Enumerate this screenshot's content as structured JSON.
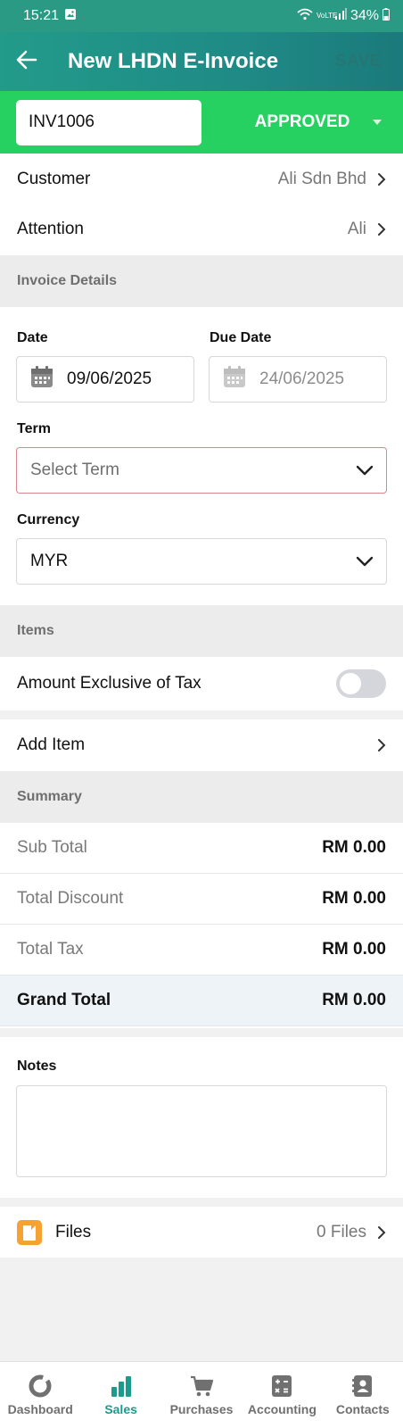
{
  "status_bar": {
    "time": "15:21",
    "network": "VoLTE",
    "battery": "34%"
  },
  "app_bar": {
    "title": "New LHDN E-Invoice",
    "save_label": "SAVE"
  },
  "invoice": {
    "number": "INV1006",
    "status": "APPROVED"
  },
  "party": {
    "customer_label": "Customer",
    "customer_value": "Ali Sdn Bhd",
    "attention_label": "Attention",
    "attention_value": "Ali"
  },
  "invoice_details": {
    "header": "Invoice Details",
    "date_label": "Date",
    "date_value": "09/06/2025",
    "due_date_label": "Due Date",
    "due_date_value": "24/06/2025",
    "term_label": "Term",
    "term_placeholder": "Select Term",
    "currency_label": "Currency",
    "currency_value": "MYR"
  },
  "items": {
    "header": "Items",
    "amount_exclusive_label": "Amount Exclusive of Tax",
    "amount_exclusive_on": false,
    "add_item_label": "Add Item"
  },
  "summary": {
    "header": "Summary",
    "rows": [
      {
        "label": "Sub Total",
        "value": "RM 0.00"
      },
      {
        "label": "Total Discount",
        "value": "RM 0.00"
      },
      {
        "label": "Total Tax",
        "value": "RM 0.00"
      },
      {
        "label": "Grand Total",
        "value": "RM 0.00"
      }
    ]
  },
  "notes": {
    "label": "Notes",
    "value": ""
  },
  "files": {
    "label": "Files",
    "count": "0 Files"
  },
  "bottom_nav": [
    {
      "label": "Dashboard",
      "icon": "donut-icon",
      "active": false
    },
    {
      "label": "Sales",
      "icon": "bar-chart-icon",
      "active": true
    },
    {
      "label": "Purchases",
      "icon": "cart-icon",
      "active": false
    },
    {
      "label": "Accounting",
      "icon": "calculator-icon",
      "active": false
    },
    {
      "label": "Contacts",
      "icon": "contact-book-icon",
      "active": false
    }
  ],
  "colors": {
    "primary": "#1f8a86",
    "status_green": "#26d162",
    "active_nav": "#1c9b8c",
    "files_orange": "#f5a233"
  }
}
